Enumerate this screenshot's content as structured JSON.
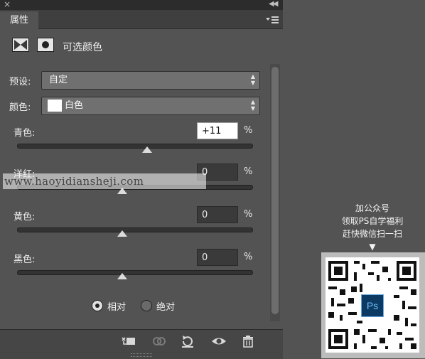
{
  "panel": {
    "tab_label": "属性",
    "title": "可选颜色",
    "preset_label": "预设:",
    "preset_value": "自定",
    "color_label": "颜色:",
    "color_value": "白色",
    "color_swatch": "#ffffff"
  },
  "sliders": [
    {
      "label": "青色:",
      "value": "+11",
      "percent": "%",
      "position": 0.055,
      "active": true
    },
    {
      "label": "洋红:",
      "value": "0",
      "percent": "%",
      "position": 0.5,
      "active": false
    },
    {
      "label": "黄色:",
      "value": "0",
      "percent": "%",
      "position": 0.5,
      "active": false
    },
    {
      "label": "黑色:",
      "value": "0",
      "percent": "%",
      "position": 0.5,
      "active": false
    }
  ],
  "method": {
    "options": [
      "相对",
      "绝对"
    ],
    "selected": "相对"
  },
  "toolbar": {
    "icons": [
      "clip-to-layer-icon",
      "view-previous-state-icon",
      "reset-icon",
      "visibility-icon",
      "delete-icon"
    ]
  },
  "watermark": "www.haoyidiansheji.com",
  "promo": {
    "line1": "加公众号",
    "line2": "领取PS自学福利",
    "line3": "赶快微信扫一扫",
    "arrow": "▼",
    "badge": "Ps"
  }
}
